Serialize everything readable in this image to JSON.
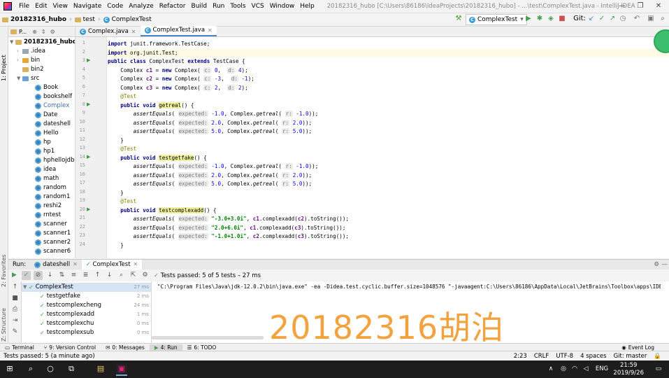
{
  "menu": [
    "File",
    "Edit",
    "View",
    "Navigate",
    "Code",
    "Analyze",
    "Refactor",
    "Build",
    "Run",
    "Tools",
    "VCS",
    "Window",
    "Help"
  ],
  "window_title": "20182316_hubo [C:\\Users\\86186\\IdeaProjects\\20182316_hubo] - ...\\test\\ComplexTest.java - IntelliJ IDEA",
  "nav": {
    "project": "20182316_hubo",
    "folder": "test",
    "file": "ComplexTest",
    "run_config": "ComplexTest",
    "git_label": "Git:"
  },
  "project_panel": {
    "title": "P...",
    "root": "20182316_hubo",
    "items": [
      ".idea",
      "bin",
      "bin2",
      "src",
      "Book",
      "bookshelf",
      "Complex",
      "Date",
      "dateshell",
      "Hello",
      "hp",
      "hp1",
      "hphellojdb",
      "idea",
      "math",
      "random",
      "random1",
      "reshi2",
      "rntest",
      "scanner",
      "scanner1",
      "scanner2",
      "scanner6"
    ]
  },
  "tabs": [
    "Complex.java",
    "ComplexTest.java"
  ],
  "code": {
    "line_numbers": [
      "1",
      "2",
      "3",
      "4",
      "5",
      "6",
      "7",
      "8",
      "9",
      "10",
      "11",
      "12",
      "13",
      "14",
      "15",
      "16",
      "17",
      "18",
      "19",
      "20",
      "21",
      "22",
      "23",
      "24"
    ],
    "import1": "junit.framework.TestCase;",
    "import2": "org.junit.Test;",
    "class_name": "ComplexTest",
    "extends": "TestCase {",
    "c1": "c1",
    "c2": "c2",
    "c3": "c3",
    "m1": "getreal",
    "m2": "testgetfake",
    "m3": "testcomplexadd",
    "annot": "@Test",
    "hint_c": "c:",
    "hint_d": "d:",
    "hint_exp": "expected:",
    "hint_r": "r:",
    "s1": "\"-3.0+3.0i\"",
    "s2": "\"2.0+6.0i\"",
    "s3": "\"-1.0+1.0i\""
  },
  "run_panel": {
    "run_label": "Run:",
    "tab1": "dateshell",
    "tab2": "ComplexTest",
    "status": "Tests passed:",
    "status_count": "5",
    "status_rest": "of 5 tests – 27 ms",
    "tests": [
      {
        "name": "ComplexTest",
        "time": "27 ms"
      },
      {
        "name": "testgetfake",
        "time": "2 ms"
      },
      {
        "name": "testcomplexcheng",
        "time": "24 ms"
      },
      {
        "name": "testcomplexadd",
        "time": "1 ms"
      },
      {
        "name": "testcomplexchu",
        "time": "0 ms"
      },
      {
        "name": "testcomplexsub",
        "time": "0 ms"
      }
    ],
    "cmdline": "\"C:\\Program Files\\Java\\jdk-12.0.2\\bin\\java.exe\" -ea -Didea.test.cyclic.buffer.size=1048576 \"-javaagent:C:\\Users\\86186\\AppData\\Local\\JetBrains\\Toolbox\\apps\\IDEA-",
    "watermark": "20182316胡泊"
  },
  "tool_strip": [
    "Terminal",
    "9: Version Control",
    "0: Messages",
    "4: Run",
    "6: TODO",
    "Event Log"
  ],
  "side_labels": {
    "project": "1: Project",
    "favorites": "2: Favorites",
    "structure": "Z: Structure"
  },
  "statusbar": {
    "left": "Tests passed: 5 (a minute ago)",
    "pos": "2:23",
    "crlf": "CRLF",
    "enc": "UTF-8",
    "indent": "4 spaces",
    "git": "Git: master"
  },
  "taskbar": {
    "lang": "ENG",
    "time": "21:59",
    "date": "2019/9/26"
  }
}
